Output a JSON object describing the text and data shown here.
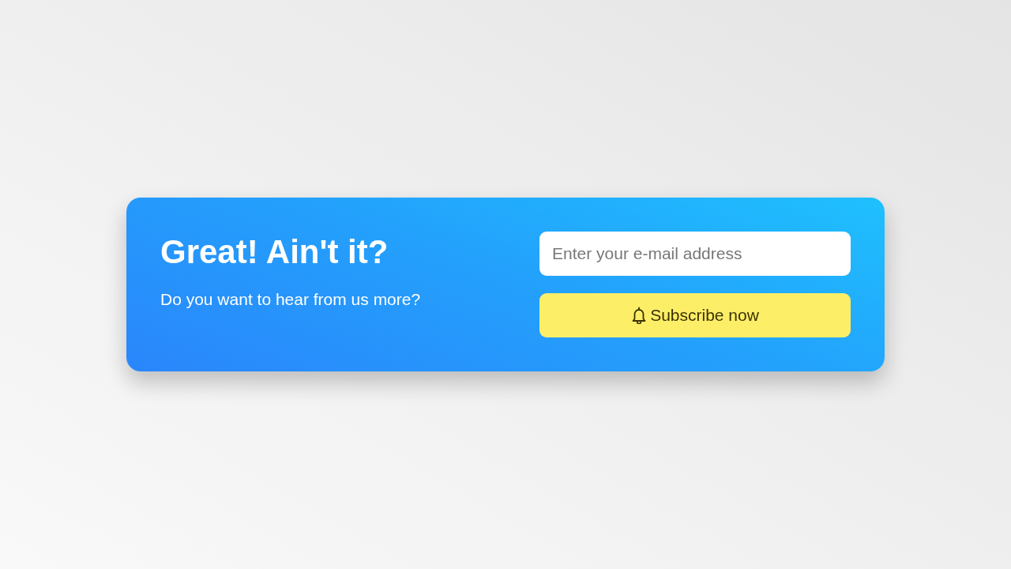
{
  "banner": {
    "title": "Great! Ain't it?",
    "subtitle": "Do you want to hear from us more?",
    "email_field": {
      "placeholder": "Enter your e-mail address"
    },
    "subscribe_button": {
      "label": "Subscribe now"
    }
  }
}
